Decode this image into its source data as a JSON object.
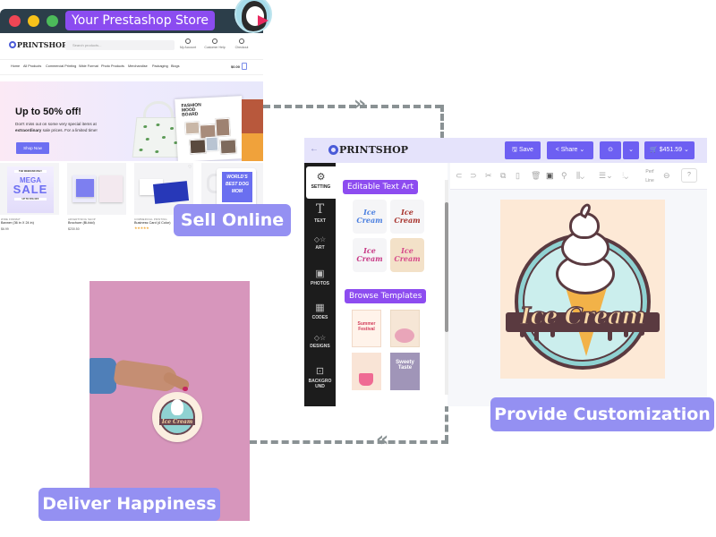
{
  "store_window": {
    "title": "Your Prestashop Store",
    "brand": "PRINTSHOP",
    "search_placeholder": "Search products...",
    "header_links": [
      "My Account",
      "Customer Help",
      "Checkout"
    ],
    "nav_items": [
      "Home",
      "All Products",
      "Commercial Printing",
      "Wide Format",
      "Photo Products",
      "Merchandise",
      "Packaging",
      "Blogs"
    ],
    "cart_total": "$0.00",
    "hero": {
      "title": "Up to 50% off!",
      "text_line1": "Don't miss out on some very special items at",
      "text_bold": "extraordinary",
      "text_line2": " sale prices. For a limited time!",
      "button": "Shop Now",
      "magazine_title": "FASHION MOOD BOARD"
    },
    "products": [
      {
        "category": "WIDE FORMAT",
        "name": "Banner (36 in X 24 in)",
        "price": "$6.99",
        "image": {
          "top": "THE WEEKEND ONLY",
          "mega": "MEGA",
          "sale": "SALE",
          "sub": "UP TO 50% OFF"
        }
      },
      {
        "category": "ADVERTISING SHOP",
        "name": "Brochure (Bi-fold)",
        "price": "$230.50"
      },
      {
        "category": "COMMERCIAL PRINTING",
        "name": "Business Card (4 Color)",
        "rating": "★★★★★"
      },
      {
        "category": "",
        "name": "",
        "image_text": "WORLD'S BEST DOG MOM"
      }
    ]
  },
  "labels": {
    "sell": "Sell Online",
    "customize": "Provide Customization",
    "deliver": "Deliver Happiness"
  },
  "designer": {
    "brand": "PRINTSHOP",
    "back_icon": "←",
    "save": "Save",
    "share": "Share",
    "cart_total": "$451.59",
    "sidebar": [
      {
        "label": "SETTING",
        "icon": "⚙"
      },
      {
        "label": "TEXT",
        "icon": "T"
      },
      {
        "label": "ART",
        "icon": "◇☆"
      },
      {
        "label": "PHOTOS",
        "icon": "▣"
      },
      {
        "label": "CODES",
        "icon": "▦"
      },
      {
        "label": "DESIGNS",
        "icon": "◇☆"
      },
      {
        "label": "BACKGROUND",
        "icon": "⊡"
      }
    ],
    "panel": {
      "text_art_heading": "Editable Text Art",
      "text_art": [
        "Ice Cream",
        "Ice Cream",
        "Ice Cream",
        "Ice Cream"
      ],
      "templates_heading": "Browse Templates",
      "templates": [
        "Summer Festival",
        "Ice Cream",
        "Ice Cream",
        "Sweety Taste"
      ]
    },
    "toolbar": {
      "icons": [
        "redo",
        "undo",
        "cut",
        "copy",
        "paste",
        "delete",
        "image",
        "layers",
        "align",
        "arrange",
        "distribute"
      ],
      "perf_line": "Perf Line",
      "help": "?"
    },
    "canvas_design_text": "Ice Cream"
  },
  "delivery_photo": {
    "sticker_text": "Ice Cream"
  },
  "colors": {
    "label_pill": "#9490f2",
    "accent_purple": "#8b4cf0",
    "button_blue": "#6d5ff2",
    "connector": "#8a9294",
    "photo_bg": "#d796bc"
  }
}
